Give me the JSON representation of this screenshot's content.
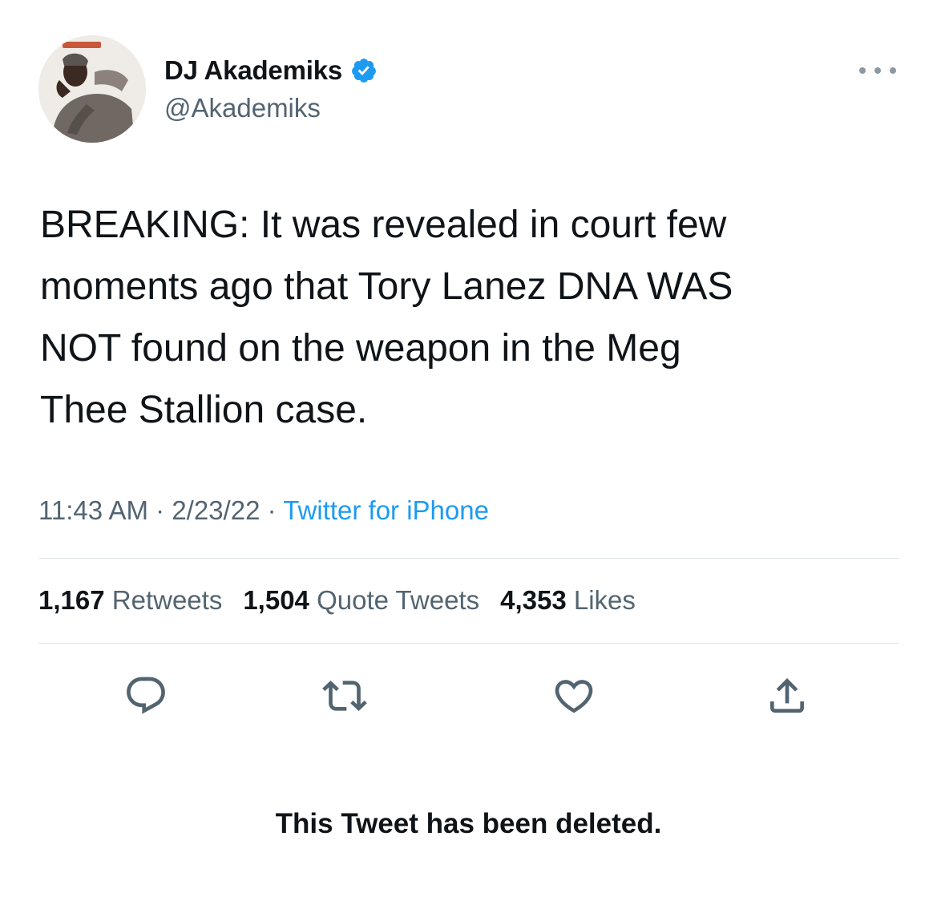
{
  "user": {
    "display_name": "DJ Akademiks",
    "handle": "@Akademiks",
    "verified": true,
    "avatar_icon": "profile-photo"
  },
  "tweet": {
    "text": "BREAKING: It was revealed in court few\nmoments ago that Tory Lanez DNA WAS\nNOT found on the weapon in the Meg\nThee Stallion case.",
    "time": "11:43 AM",
    "date": "2/23/22",
    "separator": "·",
    "source": "Twitter for iPhone"
  },
  "stats": {
    "retweets_count": "1,167",
    "retweets_label": "Retweets",
    "quotes_count": "1,504",
    "quotes_label": "Quote Tweets",
    "likes_count": "4,353",
    "likes_label": "Likes"
  },
  "actions": {
    "reply_icon": "reply-icon",
    "retweet_icon": "retweet-icon",
    "like_icon": "heart-icon",
    "share_icon": "share-icon"
  },
  "notice": "This Tweet has been deleted.",
  "colors": {
    "text_primary": "#0f1419",
    "text_secondary": "#536471",
    "accent": "#1d9bf0",
    "divider": "#e1e6ea"
  }
}
